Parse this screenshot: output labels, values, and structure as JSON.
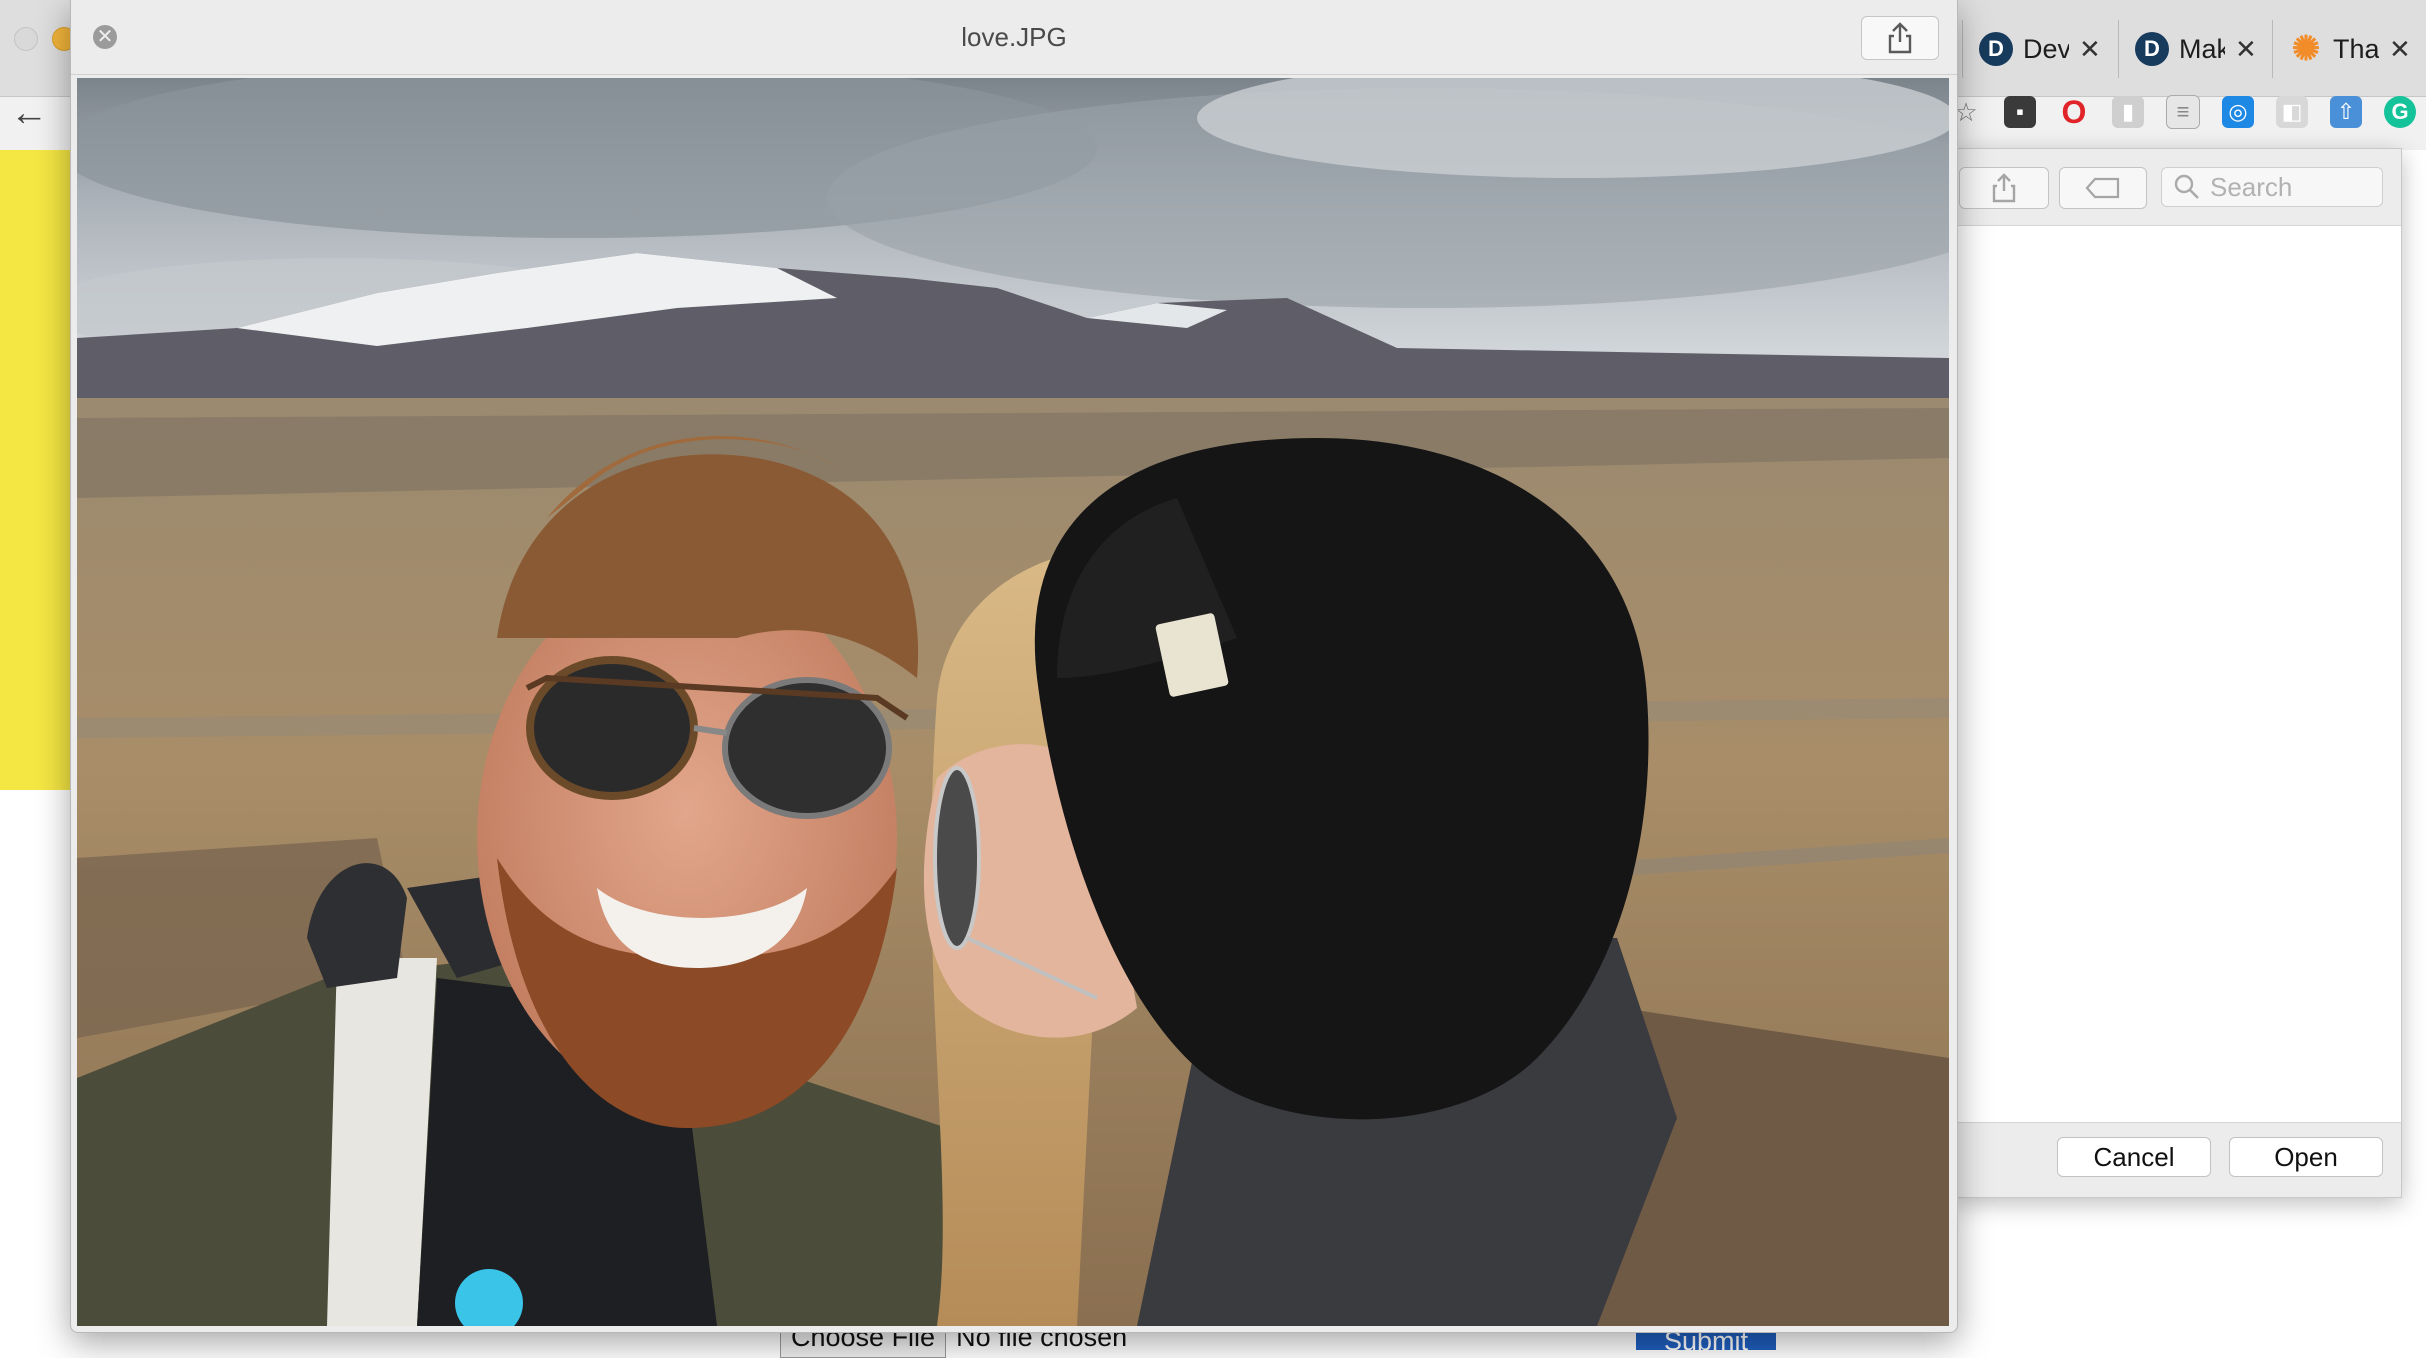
{
  "quicklook": {
    "filename": "love.JPG"
  },
  "browser": {
    "tabs": [
      {
        "icon": "D",
        "title": "Dev"
      },
      {
        "icon": "D",
        "title": "Mak"
      },
      {
        "icon": "✺",
        "title": "Tha"
      }
    ],
    "extensions": [
      "grammarly-icon"
    ]
  },
  "open_dialog": {
    "search_placeholder": "Search",
    "cancel_label": "Cancel",
    "open_label": "Open"
  },
  "page_form": {
    "choose_file_label": "Choose File",
    "no_file_text": "No file chosen",
    "submit_label": "Submit"
  },
  "colors": {
    "accent_yellow": "#f4e643",
    "submit_blue": "#1f5fbf"
  }
}
